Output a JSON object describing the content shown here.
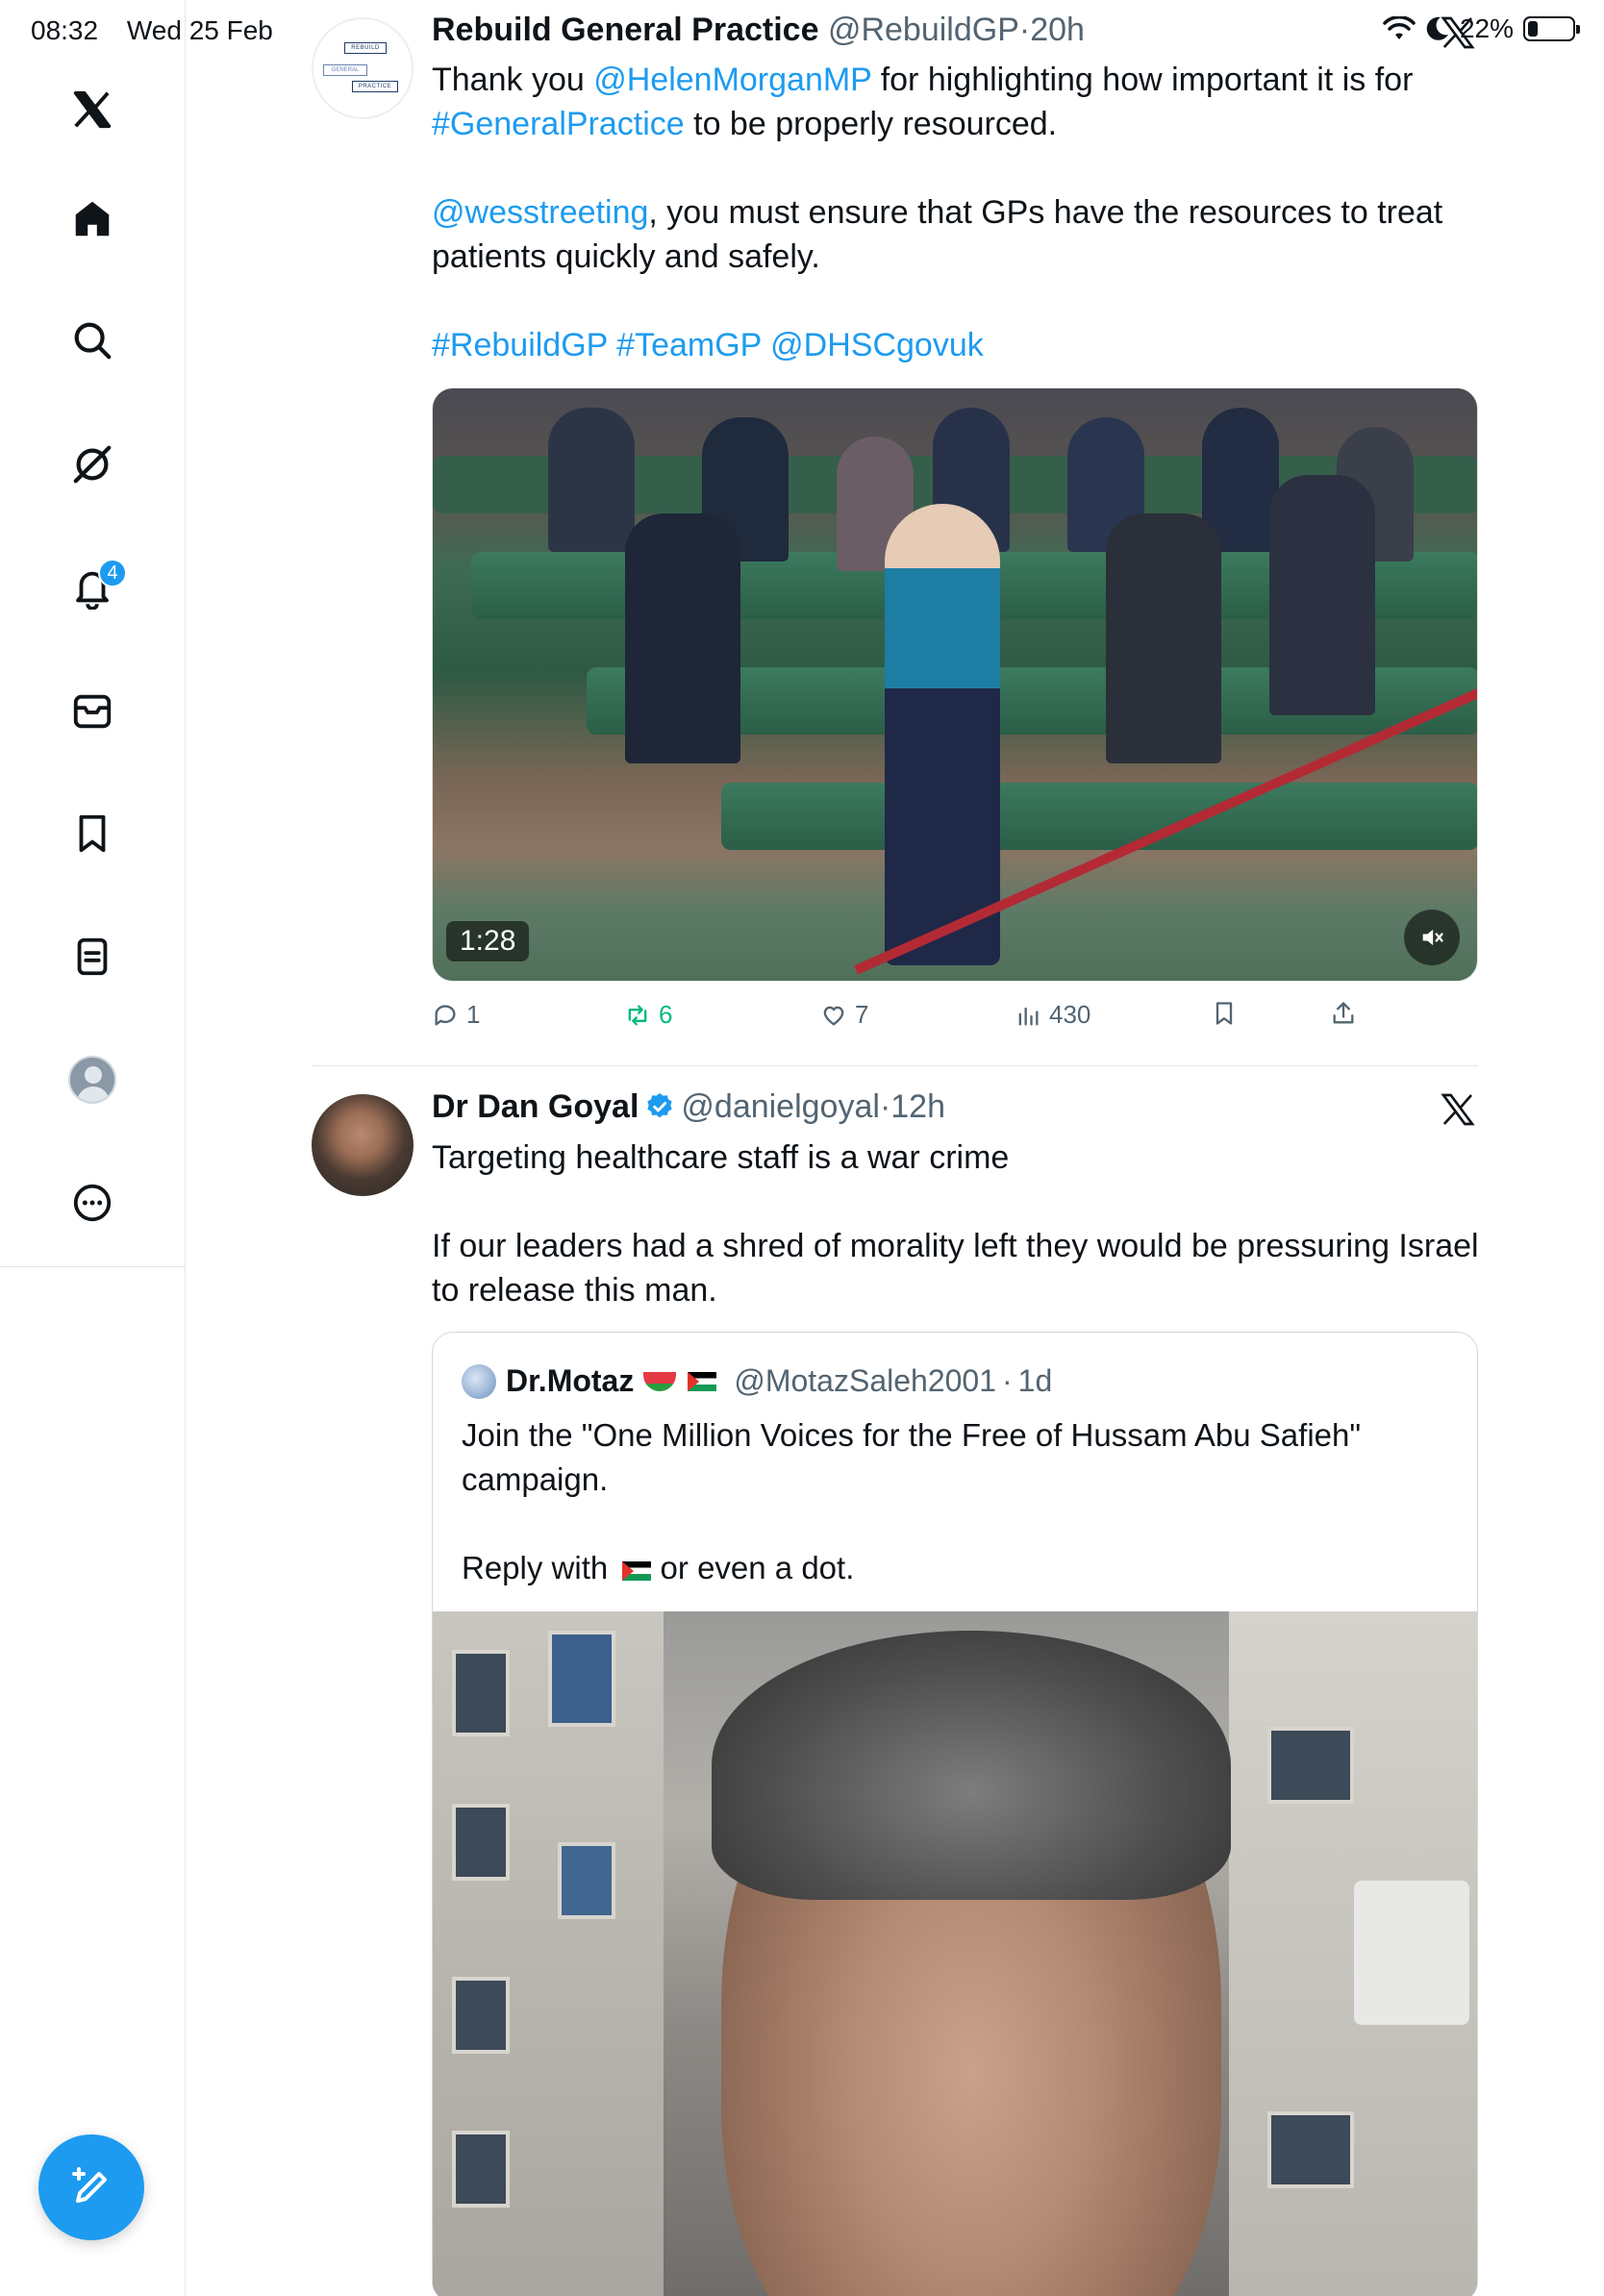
{
  "status_bar": {
    "time": "08:32",
    "date": "Wed 25 Feb",
    "battery": "22%",
    "battery_level": 0.22
  },
  "sidebar": {
    "items": [
      {
        "name": "home",
        "icon": "home-icon"
      },
      {
        "name": "explore",
        "icon": "search-icon"
      },
      {
        "name": "grok",
        "icon": "grok-icon"
      },
      {
        "name": "notifications",
        "icon": "bell-icon",
        "badge": "4"
      },
      {
        "name": "messages",
        "icon": "mail-icon"
      },
      {
        "name": "bookmarks",
        "icon": "bookmark-icon"
      },
      {
        "name": "lists",
        "icon": "list-icon"
      },
      {
        "name": "profile",
        "icon": "avatar"
      },
      {
        "name": "more",
        "icon": "more-icon"
      }
    ]
  },
  "tweet1": {
    "author": "Rebuild General Practice",
    "handle": "@RebuildGP",
    "sep": "·",
    "time": "20h",
    "logo": {
      "top": "REBUILD",
      "mid": "GENERAL",
      "bottom": "PRACTICE"
    },
    "text": {
      "l1_pre": "Thank you ",
      "l1_link": "@HelenMorganMP",
      "l1_post": " for highlighting how important it is for",
      "l2_link": "#GeneralPractice",
      "l2_post": " to be properly resourced.",
      "p2_link": "@wesstreeting",
      "p2_post": ", you must ensure that GPs have the resources to treat patients quickly and safely.",
      "tags": "#RebuildGP #TeamGP @DHSCgovuk"
    },
    "video_time": "1:28",
    "actions": {
      "replies": "1",
      "retweets": "6",
      "likes": "7",
      "views": "430"
    }
  },
  "tweet2": {
    "author": "Dr Dan Goyal",
    "handle": "@danielgoyal",
    "sep": "·",
    "time": "12h",
    "text_p1": "Targeting healthcare staff is a war crime",
    "text_p2": "If our leaders had a shred of morality left they would be pressuring Israel to release this man.",
    "quote": {
      "author": "Dr.Motaz",
      "handle": "@MotazSaleh2001",
      "sep": "·",
      "time": "1d",
      "p1": "Join the \"One Million Voices for the Free of Hussam Abu Safieh\" campaign.",
      "p2_pre": "Reply with ",
      "p2_post": " or even a dot."
    }
  },
  "colors": {
    "accent": "#1d9bf0",
    "retweet": "#00ba7c",
    "text": "#0f1419",
    "muted": "#536471"
  }
}
